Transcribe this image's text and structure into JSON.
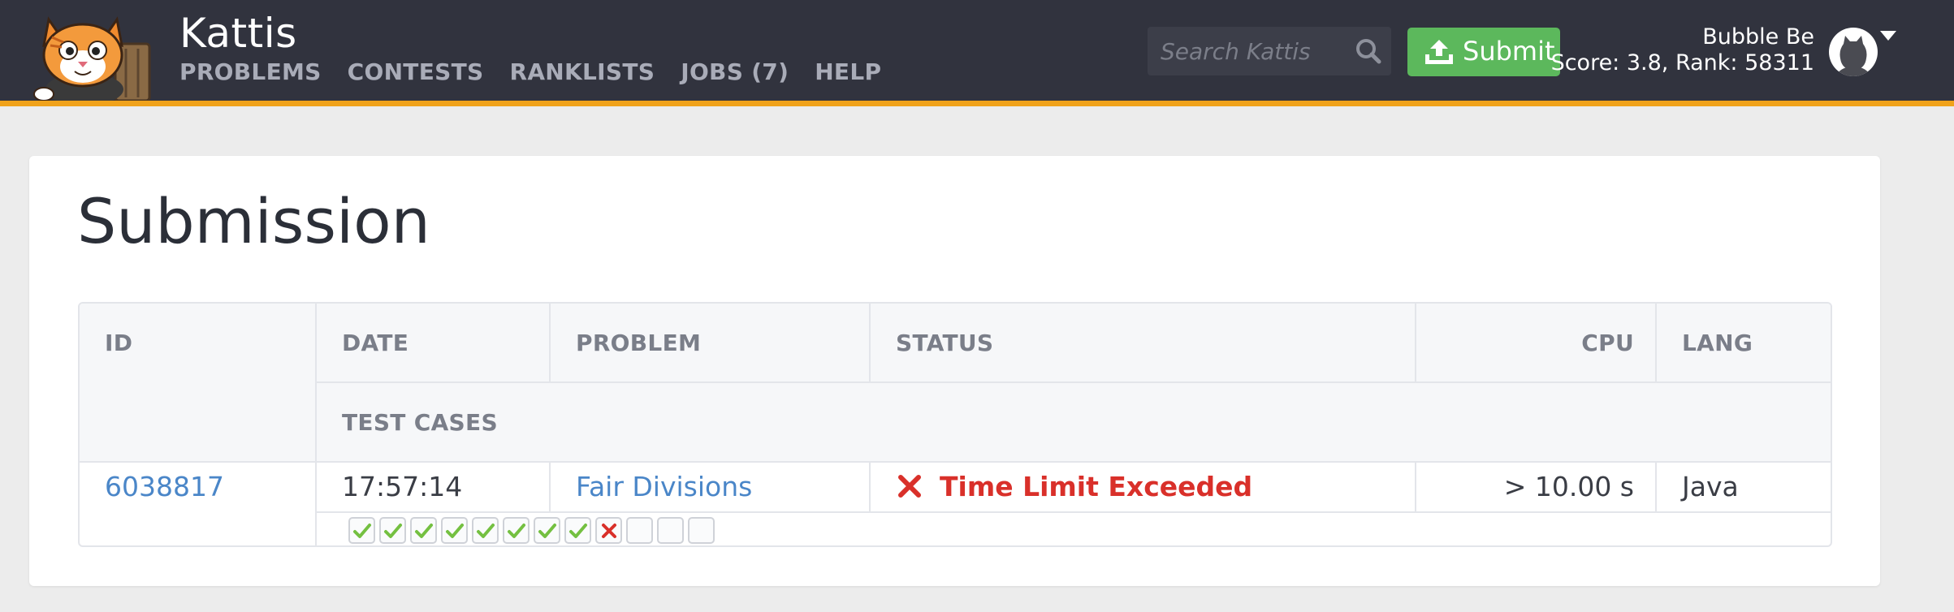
{
  "app": {
    "brand": "Kattis"
  },
  "nav": {
    "links": [
      "PROBLEMS",
      "CONTESTS",
      "RANKLISTS",
      "JOBS (7)",
      "HELP"
    ]
  },
  "search": {
    "placeholder": "Search Katti​s",
    "value": ""
  },
  "submit": {
    "label": "Submit"
  },
  "user": {
    "name": "Bubble Be",
    "score_rank": "Score: 3.8, Rank: 58311"
  },
  "page": {
    "title": "Submission"
  },
  "table": {
    "headers": {
      "id": "ID",
      "date": "DATE",
      "problem": "PROBLEM",
      "status": "STATUS",
      "cpu": "CPU",
      "lang": "LANG",
      "test_cases": "TEST CASES"
    },
    "row": {
      "id": "6038817",
      "date": "17:57:14",
      "problem": "Fair Divisions",
      "status": "Time Limit Exceeded",
      "cpu": "> 10.00 s",
      "lang": "Java"
    },
    "test_cases": [
      "accepted",
      "accepted",
      "accepted",
      "accepted",
      "accepted",
      "accepted",
      "accepted",
      "accepted",
      "rejected",
      "pending",
      "pending",
      "pending"
    ]
  },
  "colors": {
    "navbar": "#31333e",
    "accent_bar": "#f0a21b",
    "submit_green": "#5cb85c",
    "link_blue": "#4a86c8",
    "error_red": "#d9302a",
    "check_green": "#74c041"
  }
}
